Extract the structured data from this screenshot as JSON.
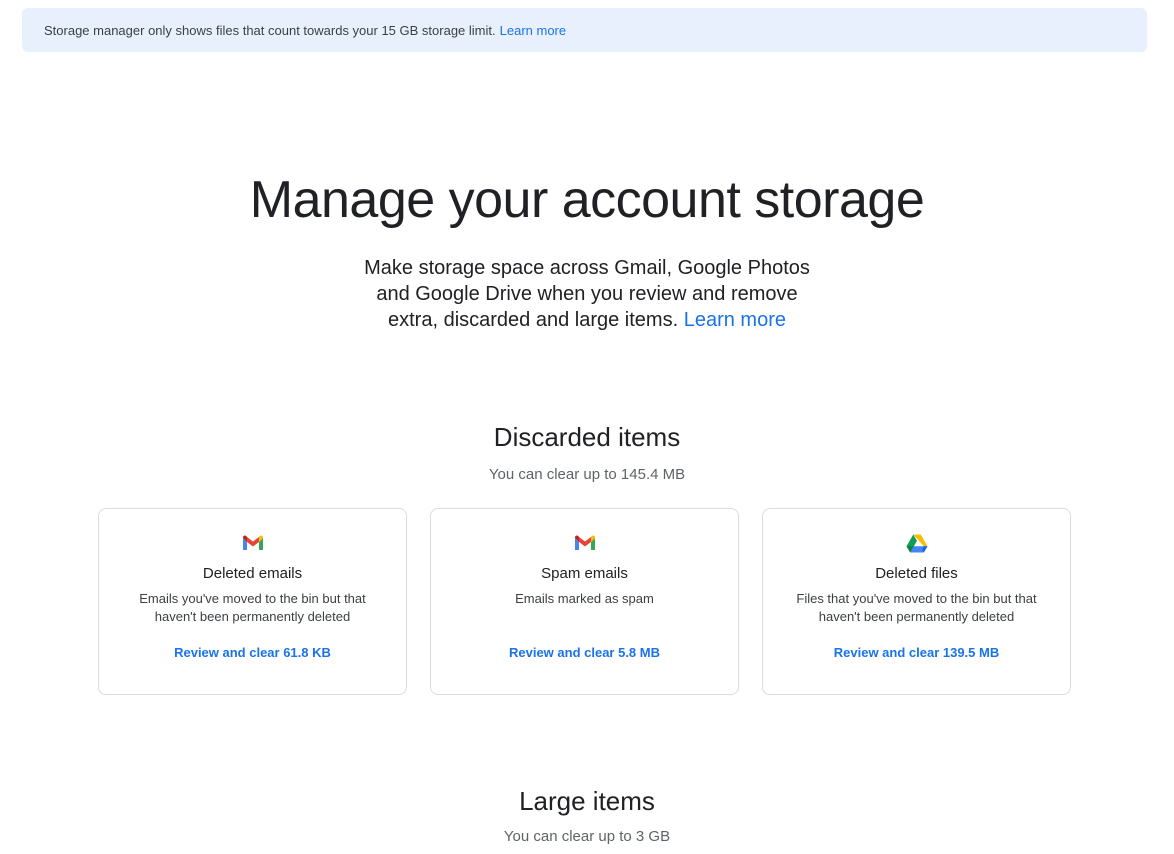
{
  "banner": {
    "text": "Storage manager only shows files that count towards your 15 GB storage limit.",
    "link": "Learn more"
  },
  "hero": {
    "title": "Manage your account storage",
    "line1": "Make storage space across Gmail, Google Photos",
    "line2": "and Google Drive when you review and remove",
    "line3": "extra, discarded and large items.",
    "link": "Learn more"
  },
  "discarded": {
    "title": "Discarded items",
    "subtitle": "You can clear up to 145.4 MB",
    "cards": [
      {
        "icon": "gmail-icon",
        "title": "Deleted emails",
        "description": "Emails you've moved to the bin but that haven't been permanently deleted",
        "action": "Review and clear 61.8 KB"
      },
      {
        "icon": "gmail-icon",
        "title": "Spam emails",
        "description": "Emails marked as spam",
        "action": "Review and clear 5.8 MB"
      },
      {
        "icon": "google-drive-icon",
        "title": "Deleted files",
        "description": "Files that you've moved to the bin but that haven't been permanently deleted",
        "action": "Review and clear 139.5 MB"
      }
    ]
  },
  "large": {
    "title": "Large items",
    "subtitle": "You can clear up to 3 GB"
  },
  "colors": {
    "accent": "#1a73e8",
    "banner_bg": "#e8f0fe",
    "card_border": "#dadce0"
  }
}
